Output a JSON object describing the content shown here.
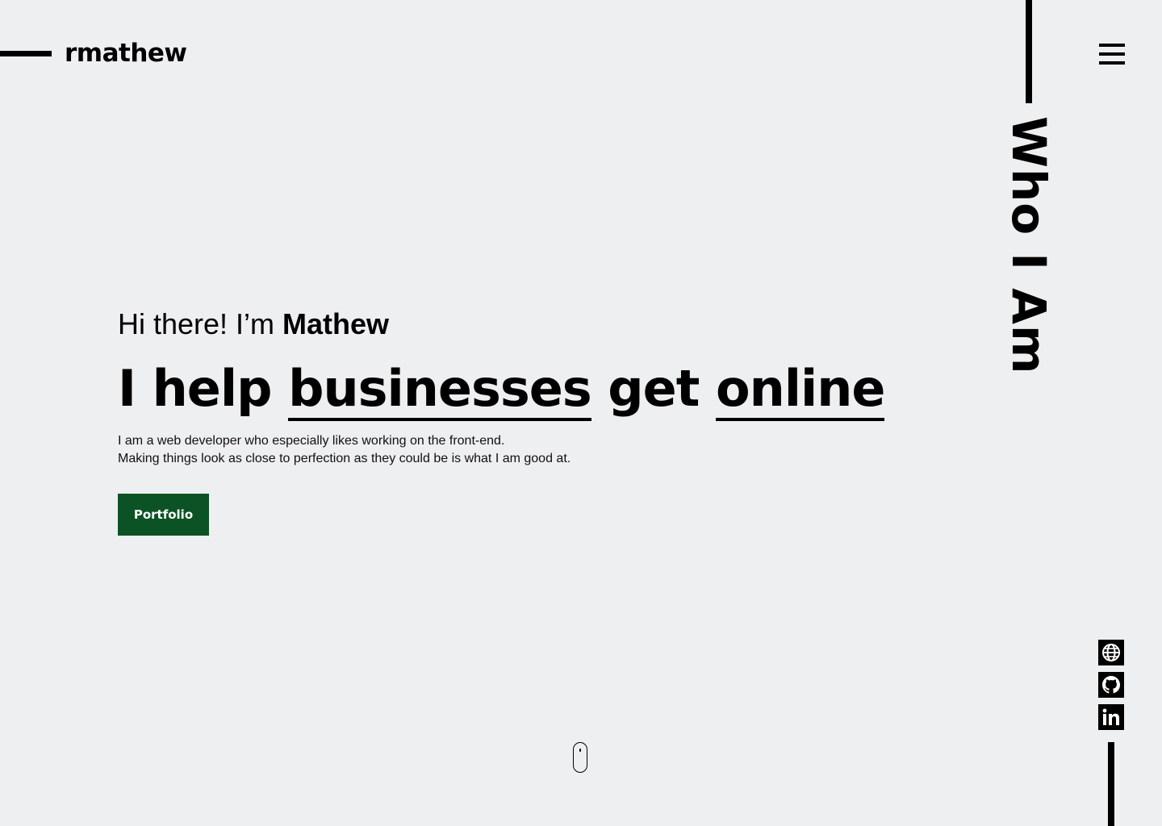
{
  "header": {
    "logo_text": "rmathew",
    "menu_icon": "hamburger-menu-icon"
  },
  "side": {
    "section_title": "Who I Am"
  },
  "hero": {
    "greeting_prefix": "Hi there! I’m ",
    "greeting_name": "Mathew",
    "headline": {
      "word1": "I help",
      "word2": "businesses",
      "word3": "get",
      "word4": "online"
    },
    "description_line1": "I am a web developer who especially likes working on the front-end.",
    "description_line2": "Making things look as close to perfection as they could be is what I am good at.",
    "portfolio_label": "Portfolio"
  },
  "socials": [
    {
      "icon": "globe-icon"
    },
    {
      "icon": "github-icon"
    },
    {
      "icon": "linkedin-icon"
    }
  ],
  "colors": {
    "background": "#eeeff1",
    "accent": "#0b5324",
    "text": "#000000"
  }
}
